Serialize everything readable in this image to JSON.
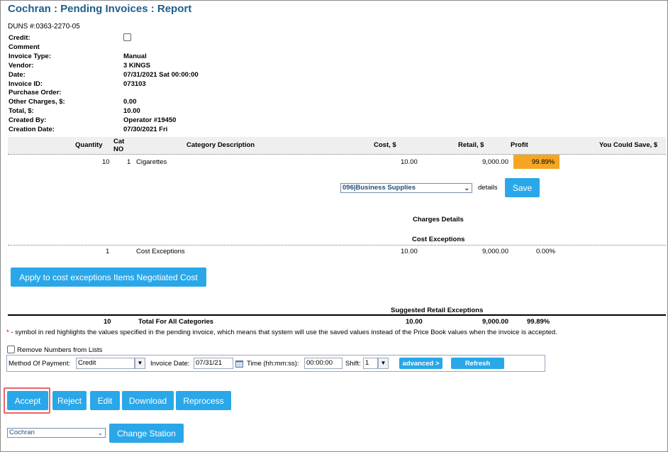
{
  "header": {
    "title": "Cochran : Pending Invoices : Report",
    "duns": "DUNS #:0363-2270-05"
  },
  "invoice_info": [
    {
      "label": "Credit:",
      "value": ""
    },
    {
      "label": "Comment",
      "value": ""
    },
    {
      "label": "Invoice Type:",
      "value": "Manual"
    },
    {
      "label": "Vendor:",
      "value": "3 KINGS"
    },
    {
      "label": "Date:",
      "value": "07/31/2021 Sat 00:00:00"
    },
    {
      "label": "Invoice ID:",
      "value": "073103"
    },
    {
      "label": "Purchase Order:",
      "value": ""
    },
    {
      "label": "Other Charges, $:",
      "value": "0.00"
    },
    {
      "label": "Total, $:",
      "value": "10.00"
    },
    {
      "label": "Created By:",
      "value": "Operator #19450"
    },
    {
      "label": "Creation Date:",
      "value": "07/30/2021 Fri"
    }
  ],
  "table": {
    "headers": {
      "quantity": "Quantity",
      "cat_no_1": "Cat",
      "cat_no_2": "NO",
      "category_description": "Category Description",
      "cost": "Cost, $",
      "retail": "Retail, $",
      "profit": "Profit",
      "you_could_save": "You Could Save, $"
    },
    "rows": [
      {
        "quantity": "10",
        "cat_no": "1",
        "description": "Cigarettes",
        "cost": "10.00",
        "retail": "9,000.00",
        "profit": "99.89%"
      }
    ]
  },
  "category_select": {
    "value": "096|Business Supplies",
    "details_label": "details",
    "save_label": "Save"
  },
  "charges_details_label": "Charges Details",
  "cost_exceptions": {
    "title": "Cost Exceptions",
    "rows": [
      {
        "quantity": "1",
        "description": "Cost Exceptions",
        "cost": "10.00",
        "retail": "9,000.00",
        "profit": "0.00%"
      }
    ],
    "apply_button": "Apply to cost exceptions Items Negotiated Cost"
  },
  "suggested_retail_label": "Suggested Retail Exceptions",
  "totals": {
    "quantity": "10",
    "label": "Total For All Categories",
    "cost": "10.00",
    "retail": "9,000.00",
    "profit": "99.89%"
  },
  "note": {
    "star": "*",
    "text": " - symbol in red highlights the values specified in the pending invoice, which means that system will use the saved values instead of the Price Book values when the invoice is accepted."
  },
  "remove_numbers_label": "Remove Numbers from Lists",
  "payment": {
    "method_label": "Method Of Payment:",
    "method_value": "Credit",
    "invoice_date_label": "Invoice Date:",
    "invoice_date_value": "07/31/21",
    "time_label": "Time (hh:mm:ss):",
    "time_value": "00:00:00",
    "shift_label": "Shift:",
    "shift_value": "1",
    "advanced_label": "advanced >",
    "refresh_label": "Refresh"
  },
  "actions": {
    "accept": "Accept",
    "reject": "Reject",
    "edit": "Edit",
    "download": "Download",
    "reprocess": "Reprocess"
  },
  "station": {
    "value": "Cochran",
    "change_label": "Change Station"
  },
  "colors": {
    "accent": "#2aa7e8",
    "title": "#1d5f8a",
    "profit_highlight": "#f5a623",
    "highlight_outline": "#e9646a"
  }
}
